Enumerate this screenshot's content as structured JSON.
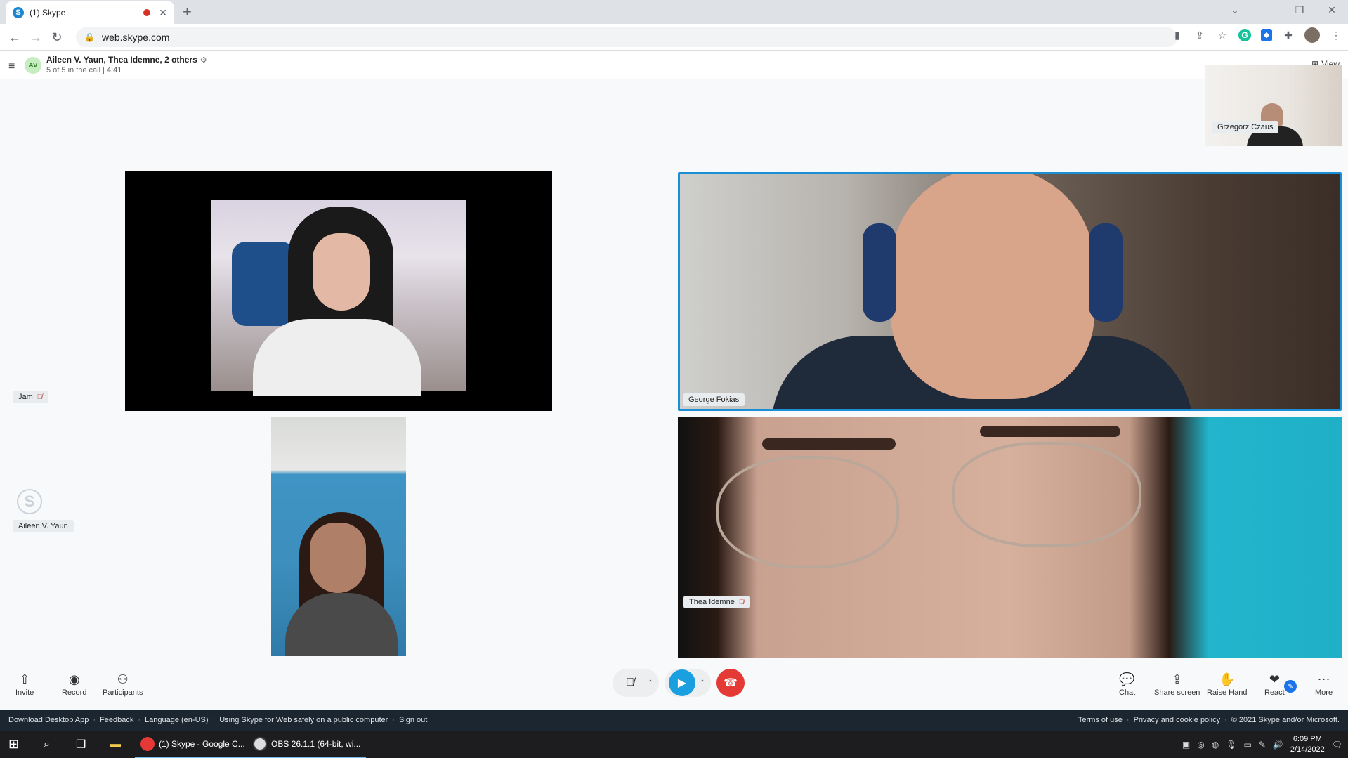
{
  "browser": {
    "tab_title": "(1) Skype",
    "tab_favicon": "S",
    "new_tab": "+",
    "url": "web.skype.com"
  },
  "call": {
    "avatar_initials": "AV",
    "title": "Aileen V. Yaun, Thea Idemne, 2 others",
    "subtitle": "5 of 5 in the call | 4:41",
    "view_label": "View"
  },
  "participants": {
    "jam": "Jam",
    "aileen": "Aileen V. Yaun",
    "george": "George Fokias",
    "thea": "Thea Idemne",
    "grzegorz": "Grzegorz Czaus"
  },
  "controls": {
    "invite": "Invite",
    "record": "Record",
    "participants": "Participants",
    "chat": "Chat",
    "share_screen": "Share screen",
    "raise_hand": "Raise Hand",
    "react": "React",
    "more": "More"
  },
  "footer": {
    "download": "Download Desktop App",
    "feedback": "Feedback",
    "language": "Language (en-US)",
    "safety": "Using Skype for Web safely on a public computer",
    "signout": "Sign out",
    "terms": "Terms of use",
    "privacy": "Privacy and cookie policy",
    "copyright": "© 2021 Skype and/or Microsoft."
  },
  "taskbar": {
    "chrome_app": "(1) Skype - Google C...",
    "obs_app": "OBS 26.1.1 (64-bit, wi...",
    "time": "6:09 PM",
    "date": "2/14/2022"
  },
  "colors": {
    "accent": "#1a9fe0",
    "end_call": "#e53935",
    "footer_bg": "#1b2631"
  }
}
